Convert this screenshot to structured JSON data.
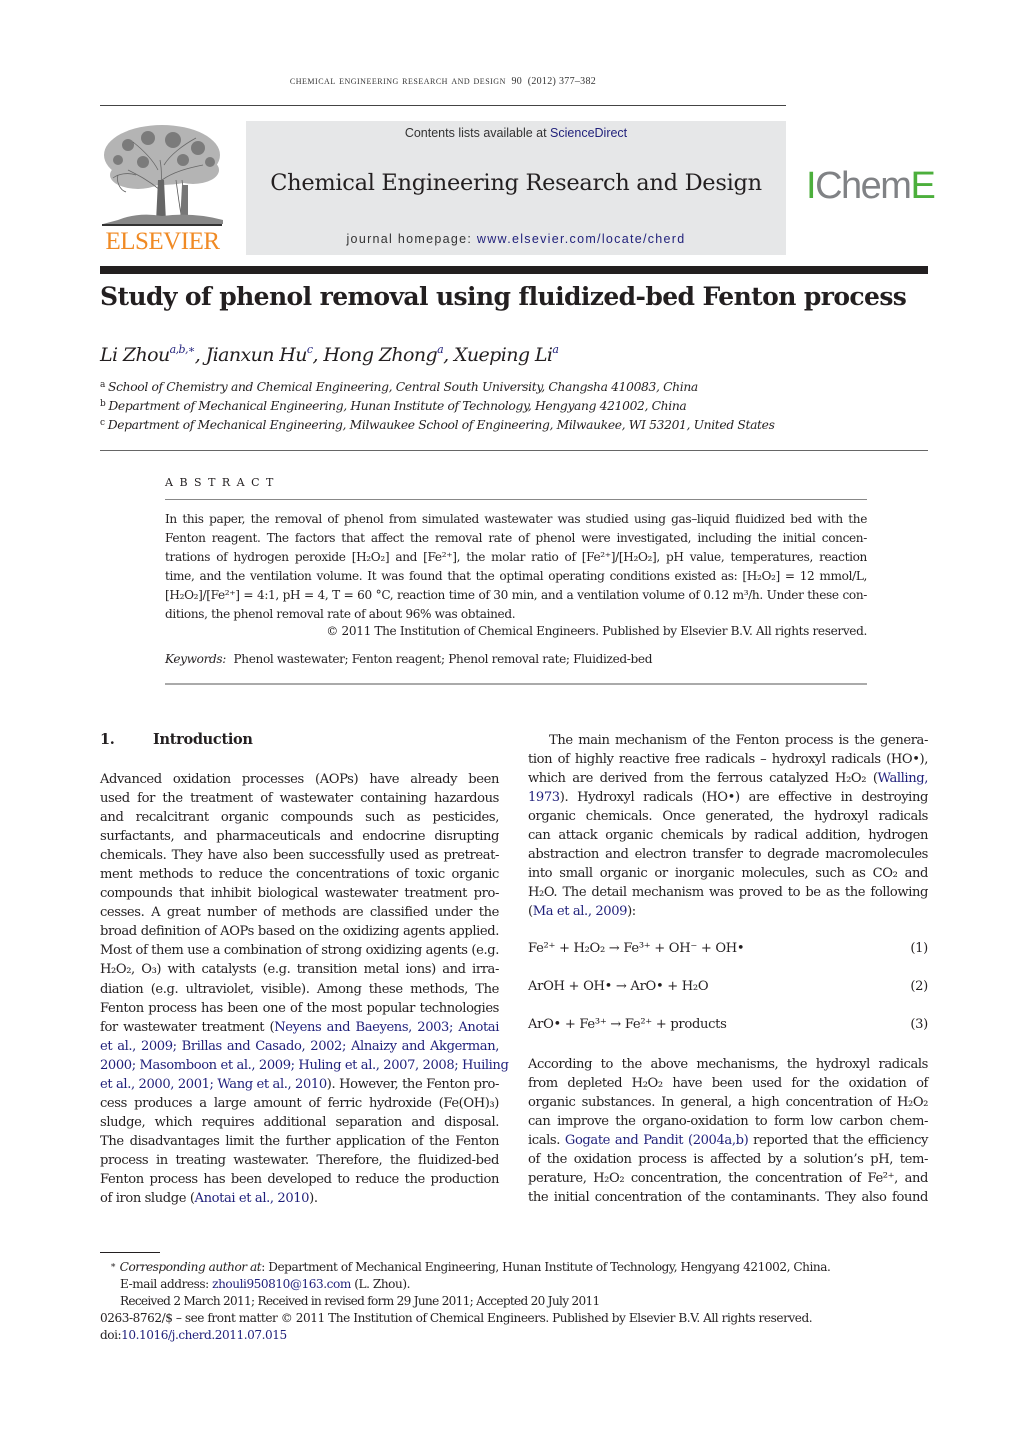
{
  "running_head": {
    "journal": "Chemical Engineering Research and Design",
    "volume": "90",
    "year": "(2012)",
    "pages": "377–382"
  },
  "header": {
    "publisher_logo": "ELSEVIER",
    "contents_prefix": "Contents lists available at ",
    "contents_link": "ScienceDirect",
    "journal_title": "Chemical Engineering Research and Design",
    "homepage_prefix": "journal homepage: ",
    "homepage_link": "www.elsevier.com/locate/cherd",
    "society_logo": {
      "part1": "I",
      "part2": "Chem",
      "part3": "E"
    }
  },
  "colors": {
    "elsevier_orange": "#f08a24",
    "icheme_green": "#4caf3c",
    "icheme_gray": "#808285",
    "link_blue": "#1f1f7a",
    "banner_gray": "#e6e7e8",
    "text": "#231f20"
  },
  "article": {
    "title": "Study of phenol removal using fluidized-bed Fenton process",
    "authors": [
      {
        "name": "Li Zhou",
        "affil": "a,b,∗"
      },
      {
        "name": "Jianxun Hu",
        "affil": "c"
      },
      {
        "name": "Hong Zhong",
        "affil": "a"
      },
      {
        "name": "Xueping Li",
        "affil": "a"
      }
    ],
    "affiliations": [
      {
        "key": "a",
        "text": "School of Chemistry and Chemical Engineering, Central South University, Changsha 410083, China"
      },
      {
        "key": "b",
        "text": "Department of Mechanical Engineering, Hunan Institute of Technology, Hengyang 421002, China"
      },
      {
        "key": "c",
        "text": "Department of Mechanical Engineering, Milwaukee School of Engineering, Milwaukee, WI 53201, United States"
      }
    ]
  },
  "abstract": {
    "heading": "ABSTRACT",
    "lines": [
      "In this paper, the removal of phenol from simulated wastewater was studied using gas–liquid fluidized bed with the",
      "Fenton reagent. The factors that affect the removal rate of phenol were investigated, including the initial concen-",
      "trations of hydrogen peroxide [H₂O₂] and [Fe²⁺], the molar ratio of [Fe²⁺]/[H₂O₂], pH value, temperatures, reaction",
      "time, and the ventilation volume. It was found that the optimal operating conditions existed as: [H₂O₂] = 12 mmol/L,",
      "[H₂O₂]/[Fe²⁺] = 4:1, pH = 4, T = 60 °C, reaction time of 30 min, and a ventilation volume of 0.12 m³/h. Under these con-",
      "ditions, the phenol removal rate of about 96% was obtained."
    ],
    "copyright": "© 2011 The Institution of Chemical Engineers. Published by Elsevier B.V. All rights reserved.",
    "keywords_label": "Keywords:",
    "keywords": "Phenol wastewater; Fenton reagent; Phenol removal rate; Fluidized-bed"
  },
  "section": {
    "number": "1.",
    "title": "Introduction"
  },
  "intro_left": [
    {
      "t": "Advanced oxidation processes (AOPs) have already been"
    },
    {
      "t": "used for the treatment of wastewater containing hazardous"
    },
    {
      "t": "and recalcitrant organic compounds such as pesticides,"
    },
    {
      "t": "surfactants, and pharmaceuticals and endocrine disrupting"
    },
    {
      "t": "chemicals. They have also been successfully used as pretreat-"
    },
    {
      "t": "ment methods to reduce the concentrations of toxic organic"
    },
    {
      "t": "compounds that inhibit biological wastewater treatment pro-"
    },
    {
      "t": "cesses. A great number of methods are classified under the"
    },
    {
      "t": "broad definition of AOPs based on the oxidizing agents applied."
    },
    {
      "t": "Most of them use a combination of strong oxidizing agents (e.g."
    },
    {
      "t": "H₂O₂, O₃) with catalysts (e.g. transition metal ions) and irra-"
    },
    {
      "t": "diation (e.g. ultraviolet, visible). Among these methods, The"
    },
    {
      "t": "Fenton process has been one of the most popular technologies"
    },
    {
      "t": "for wastewater treatment (",
      "link": "Neyens and Baeyens, 2003; Anotai"
    },
    {
      "link": "et al., 2009; Brillas and Casado, 2002; Alnaizy and Akgerman,"
    },
    {
      "link": "2000; Masomboon et al., 2009; Huling et al., 2007, 2008; Huiling"
    },
    {
      "link": "et al., 2000, 2001; Wang et al., 2010",
      "t2": "). However, the Fenton pro-"
    },
    {
      "t": "cess produces a large amount of ferric hydroxide (Fe(OH)₃)"
    },
    {
      "t": "sludge, which requires additional separation and disposal."
    },
    {
      "t": "The disadvantages limit the further application of the Fenton"
    },
    {
      "t": "process in treating wastewater. Therefore, the fluidized-bed"
    },
    {
      "t": "Fenton process has been developed to reduce the production"
    },
    {
      "t": "of iron sludge (",
      "link": "Anotai et al., 2010",
      "t2": ").",
      "last": true
    }
  ],
  "intro_right": [
    {
      "t": "The main mechanism of the Fenton process is the genera-",
      "indent": true
    },
    {
      "t": "tion of highly reactive free radicals – hydroxyl radicals (HO•),"
    },
    {
      "t": "which are derived from the ferrous catalyzed H₂O₂ (",
      "link": "Walling,"
    },
    {
      "link": "1973",
      "t2": "). Hydroxyl radicals (HO•) are effective in destroying"
    },
    {
      "t": "organic chemicals. Once generated, the hydroxyl radicals"
    },
    {
      "t": "can attack organic chemicals by radical addition, hydrogen"
    },
    {
      "t": "abstraction and electron transfer to degrade macromolecules"
    },
    {
      "t": "into small organic or inorganic molecules, such as CO₂ and"
    },
    {
      "t": "H₂O. The detail mechanism was proved to be as the following"
    },
    {
      "t": "(",
      "link": "Ma et al., 2009",
      "t2": "):",
      "last": true
    }
  ],
  "equations": [
    {
      "expr": "Fe²⁺ + H₂O₂ →  Fe³⁺ + OH⁻ + OH•",
      "number": "(1)"
    },
    {
      "expr": "ArOH +  OH• →  ArO• +  H₂O",
      "number": "(2)"
    },
    {
      "expr": "ArO• + Fe³⁺ →  Fe²⁺ + products",
      "number": "(3)"
    }
  ],
  "intro_right2": [
    {
      "t": "According to the above mechanisms, the hydroxyl radicals"
    },
    {
      "t": "from depleted H₂O₂ have been used for the oxidation of"
    },
    {
      "t": "organic substances. In general, a high concentration of H₂O₂"
    },
    {
      "t": "can improve the organo-oxidation to form low carbon chem-"
    },
    {
      "t": "icals. ",
      "link": "Gogate and Pandit (2004a,b)",
      "t2": " reported that the efficiency"
    },
    {
      "t": "of the oxidation process is affected by a solution’s pH, tem-"
    },
    {
      "t": "perature, H₂O₂ concentration, the concentration of Fe²⁺, and"
    },
    {
      "t": "the initial concentration of the contaminants. They also found"
    }
  ],
  "footnotes": {
    "star": "∗",
    "corresponding_label": "Corresponding author at",
    "corresponding_text": ": Department of Mechanical Engineering, Hunan Institute of Technology, Hengyang 421002, China.",
    "email_label": "E-mail address: ",
    "email": "zhouli950810@163.com",
    "email_suffix": " (L. Zhou).",
    "received": "Received 2 March 2011; Received in revised form 29 June 2011; Accepted 20 July 2011",
    "issn_line": "0263-8762/$ – see front matter © 2011 The Institution of Chemical Engineers. Published by Elsevier B.V. All rights reserved.",
    "doi_prefix": "doi:",
    "doi": "10.1016/j.cherd.2011.07.015"
  }
}
